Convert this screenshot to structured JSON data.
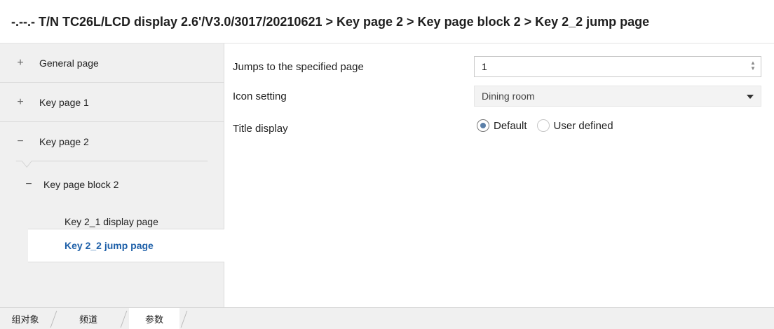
{
  "header": {
    "title": "-.--.- T/N TC26L/LCD display 2.6'/V3.0/3017/20210621 > Key page 2 > Key page block 2 > Key 2_2 jump page"
  },
  "sidebar": {
    "items": [
      {
        "sign": "+",
        "label": "General page"
      },
      {
        "sign": "+",
        "label": "Key page 1"
      },
      {
        "sign": "−",
        "label": "Key page 2"
      }
    ],
    "block": {
      "sign": "−",
      "label": "Key page block 2"
    },
    "leaves": [
      {
        "label": "Key 2_1 display page"
      },
      {
        "label": "Key 2_2 jump page",
        "active": true
      }
    ]
  },
  "form": {
    "jump": {
      "label": "Jumps to the specified page",
      "value": "1"
    },
    "icon": {
      "label": "Icon setting",
      "value": "Dining room"
    },
    "title": {
      "label": "Title display",
      "options": [
        {
          "label": "Default",
          "checked": true
        },
        {
          "label": "User defined",
          "checked": false
        }
      ]
    }
  },
  "tabs": [
    {
      "label": "组对象"
    },
    {
      "label": "频道"
    },
    {
      "label": "参数",
      "active": true
    }
  ]
}
